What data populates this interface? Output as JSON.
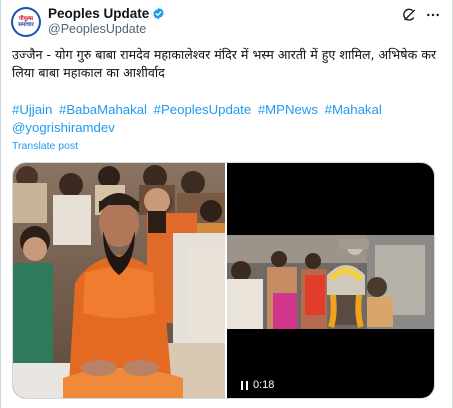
{
  "account": {
    "display_name": "Peoples Update",
    "handle": "@PeoplesUpdate",
    "avatar_text_1": "पीपुल्स",
    "avatar_text_2": "समाचार",
    "verified": true
  },
  "tweet": {
    "text": "उज्जैन - योग गुरु बाबा रामदेव महाकालेश्वर मंदिर में भस्म आरती में हुए शामिल, अभिषेक कर लिया बाबा महाकाल का आशीर्वाद",
    "hashtags": [
      "#Ujjain",
      "#BabaMahakal",
      "#PeoplesUpdate",
      "#MPNews",
      "#Mahakal"
    ],
    "mention": "@yogrishiramdev",
    "translate_label": "Translate post"
  },
  "media": {
    "video_time": "0:18"
  },
  "icons": {
    "grok": "grok-icon",
    "more": "more-icon",
    "verified": "verified-badge-icon",
    "pause": "pause-icon"
  },
  "colors": {
    "link": "#1d9bf0",
    "text": "#0f1419",
    "muted": "#536471",
    "avatar": "#1d4fb5"
  }
}
